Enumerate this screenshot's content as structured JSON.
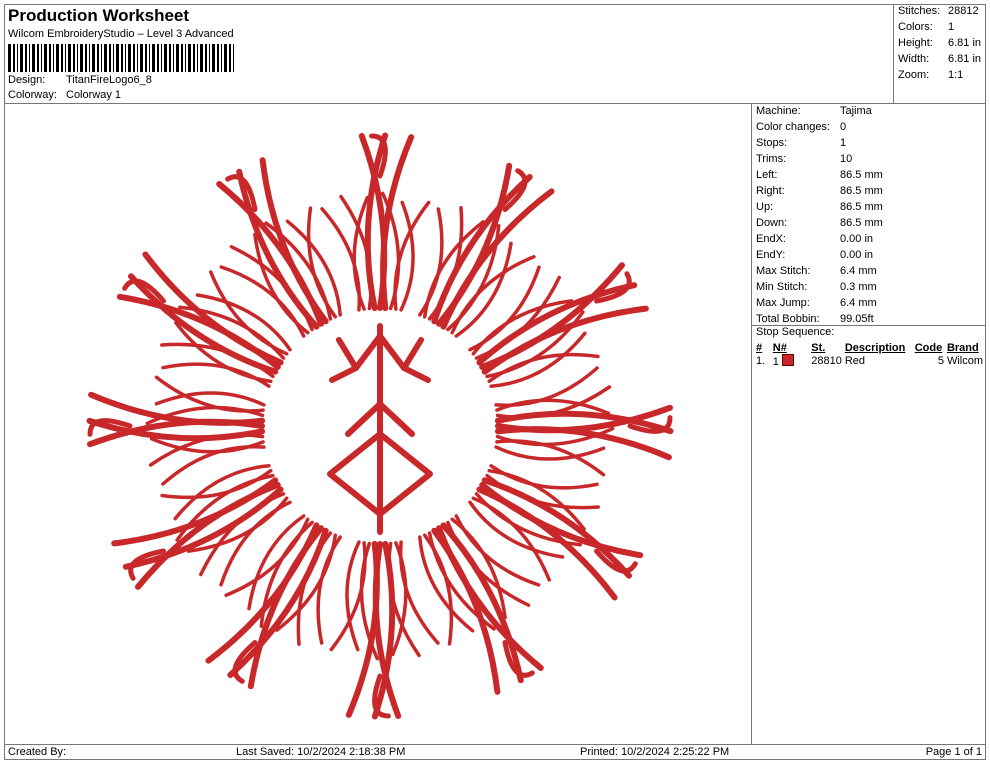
{
  "header": {
    "title": "Production Worksheet",
    "subtitle": "Wilcom EmbroideryStudio – Level 3 Advanced",
    "design_label": "Design:",
    "design_value": "TitanFireLogo6_8",
    "colorway_label": "Colorway:",
    "colorway_value": "Colorway 1"
  },
  "stats": {
    "stitches_label": "Stitches:",
    "stitches": "28812",
    "colors_label": "Colors:",
    "colors": "1",
    "height_label": "Height:",
    "height": "6.81 in",
    "width_label": "Width:",
    "width": "6.81 in",
    "zoom_label": "Zoom:",
    "zoom": "1:1"
  },
  "info": {
    "machine_label": "Machine:",
    "machine": "Tajima",
    "color_changes_label": "Color changes:",
    "color_changes": "0",
    "stops_label": "Stops:",
    "stops": "1",
    "trims_label": "Trims:",
    "trims": "10",
    "left_label": "Left:",
    "left": "86.5 mm",
    "right_label": "Right:",
    "right": "86.5 mm",
    "up_label": "Up:",
    "up": "86.5 mm",
    "down_label": "Down:",
    "down": "86.5 mm",
    "endx_label": "EndX:",
    "endx": "0.00 in",
    "endy_label": "EndY:",
    "endy": "0.00 in",
    "max_stitch_label": "Max Stitch:",
    "max_stitch": "6.4 mm",
    "min_stitch_label": "Min Stitch:",
    "min_stitch": "0.3 mm",
    "max_jump_label": "Max Jump:",
    "max_jump": "6.4 mm",
    "total_bobbin_label": "Total Bobbin:",
    "total_bobbin": "99.05ft"
  },
  "stop_sequence": {
    "title": "Stop Sequence:",
    "headers": [
      "#",
      "N#",
      "St.",
      "Description",
      "Code",
      "Brand"
    ],
    "rows": [
      {
        "index": "1.",
        "n": "1",
        "stitches": "28810",
        "description": "Red",
        "code": "5",
        "brand": "Wilcom",
        "color": "#c8282a"
      }
    ]
  },
  "footer": {
    "created_by": "Created By:",
    "last_saved": "Last Saved: 10/2/2024 2:18:38 PM",
    "printed": "Printed: 10/2/2024 2:25:22 PM",
    "page": "Page 1 of 1"
  },
  "colors": {
    "thread": "#c8282a"
  }
}
